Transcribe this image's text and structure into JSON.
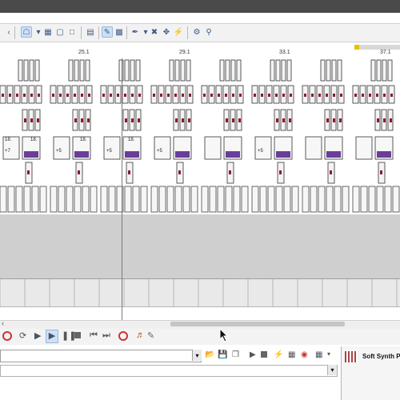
{
  "ruler": {
    "markers": [
      "25.1",
      "29.1",
      "33.1",
      "37.1"
    ]
  },
  "clips": {
    "label_a": "18.",
    "transpose_labels": [
      "+7",
      "+5",
      "+5",
      "+5",
      "+5"
    ]
  },
  "synth_panel": {
    "title": "Soft Synth Pr"
  },
  "icons": {
    "toolbar": [
      "snap-icon",
      "grid-icon",
      "select-icon",
      "edit-icon",
      "draw-icon",
      "erase-icon",
      "split-icon",
      "mute-icon"
    ],
    "transport": [
      "record-icon",
      "loop-icon",
      "play-icon",
      "play-selection-icon",
      "pause-icon",
      "stop-icon",
      "previous-icon",
      "next-icon",
      "record-arm-icon",
      "metronome-icon"
    ]
  },
  "colors": {
    "accent": "#6a3d9a",
    "marker": "#e6c200",
    "clip_mark": "#8b1a2e"
  }
}
